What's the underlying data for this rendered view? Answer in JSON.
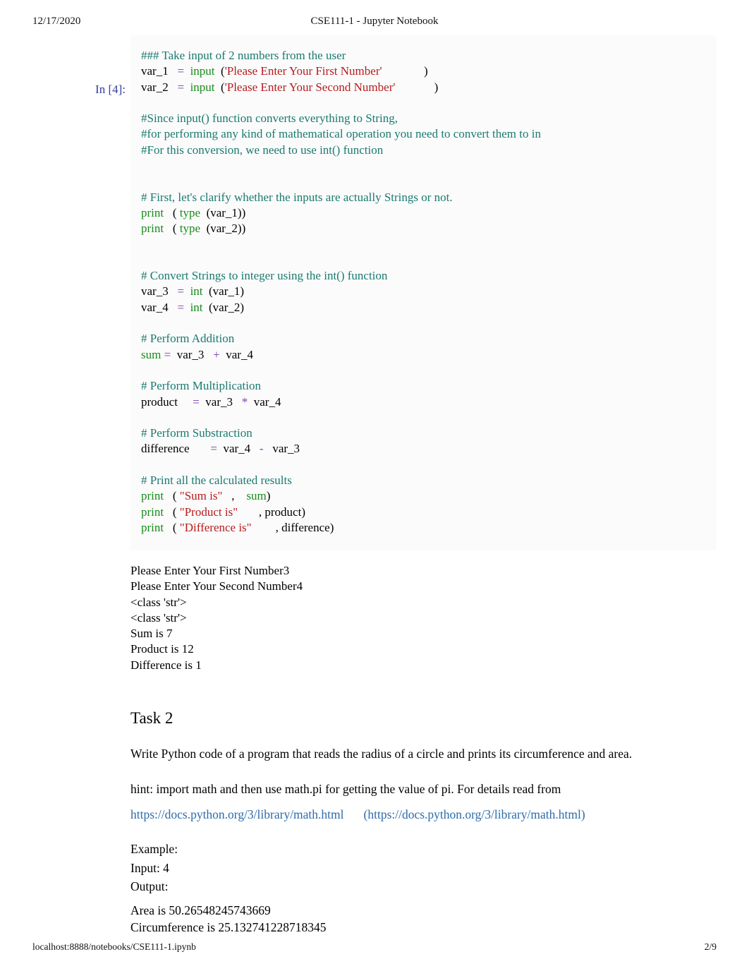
{
  "page": {
    "header": {
      "date": "12/17/2020",
      "title": "CSE111-1 - Jupyter Notebook"
    },
    "footer": {
      "url": "localhost:8888/notebooks/CSE111-1.ipynb",
      "page_number": "2/9"
    }
  },
  "colors": {
    "comment": "#1a7a6f",
    "keyword": "#198c19",
    "string": "#b71c1c",
    "operator": "#7a3ea8",
    "prompt": "#303f9f",
    "link": "#2d6ca8",
    "cell_background": "#fbfbfc",
    "page_background": "#ffffff"
  },
  "code_cell": {
    "prompt": "In [4]:",
    "lines": [
      [
        {
          "t": "### Take input of 2 numbers from the user",
          "c": "comment"
        }
      ],
      [
        {
          "t": "var_1",
          "c": "plain"
        },
        {
          "t": "   ",
          "c": "plain"
        },
        {
          "t": "=",
          "c": "operator"
        },
        {
          "t": "  ",
          "c": "plain"
        },
        {
          "t": "input",
          "c": "builtin"
        },
        {
          "t": "  (",
          "c": "plain"
        },
        {
          "t": "'Please Enter Your First Number'",
          "c": "string"
        },
        {
          "t": "              )",
          "c": "plain"
        }
      ],
      [
        {
          "t": "var_2",
          "c": "plain"
        },
        {
          "t": "   ",
          "c": "plain"
        },
        {
          "t": "=",
          "c": "operator"
        },
        {
          "t": "  ",
          "c": "plain"
        },
        {
          "t": "input",
          "c": "builtin"
        },
        {
          "t": "  (",
          "c": "plain"
        },
        {
          "t": "'Please Enter Your Second Number'",
          "c": "string"
        },
        {
          "t": "             )",
          "c": "plain"
        }
      ],
      [],
      [
        {
          "t": "#Since input() function converts everything to String,",
          "c": "comment"
        }
      ],
      [
        {
          "t": "#for performing any kind of mathematical operation you need to convert them to in",
          "c": "comment"
        }
      ],
      [
        {
          "t": "#For this conversion, we need to use int() function",
          "c": "comment"
        }
      ],
      [],
      [],
      [
        {
          "t": "# First, let's clarify whether the inputs are actually Strings or not.",
          "c": "comment"
        }
      ],
      [
        {
          "t": "print",
          "c": "builtin"
        },
        {
          "t": "   ( ",
          "c": "plain"
        },
        {
          "t": "type",
          "c": "builtin"
        },
        {
          "t": "  (var_1))",
          "c": "plain"
        }
      ],
      [
        {
          "t": "print",
          "c": "builtin"
        },
        {
          "t": "   ( ",
          "c": "plain"
        },
        {
          "t": "type",
          "c": "builtin"
        },
        {
          "t": "  (var_2))",
          "c": "plain"
        }
      ],
      [],
      [],
      [
        {
          "t": "# Convert Strings to integer using the int() function",
          "c": "comment"
        }
      ],
      [
        {
          "t": "var_3",
          "c": "plain"
        },
        {
          "t": "   ",
          "c": "plain"
        },
        {
          "t": "=",
          "c": "operator"
        },
        {
          "t": "  ",
          "c": "plain"
        },
        {
          "t": "int",
          "c": "builtin"
        },
        {
          "t": "  (var_1)",
          "c": "plain"
        }
      ],
      [
        {
          "t": "var_4",
          "c": "plain"
        },
        {
          "t": "   ",
          "c": "plain"
        },
        {
          "t": "=",
          "c": "operator"
        },
        {
          "t": "  ",
          "c": "plain"
        },
        {
          "t": "int",
          "c": "builtin"
        },
        {
          "t": "  (var_2)",
          "c": "plain"
        }
      ],
      [],
      [
        {
          "t": "# Perform Addition",
          "c": "comment"
        }
      ],
      [
        {
          "t": "sum",
          "c": "builtin"
        },
        {
          "t": " ",
          "c": "plain"
        },
        {
          "t": "=",
          "c": "operator"
        },
        {
          "t": "  var_3",
          "c": "plain"
        },
        {
          "t": "   ",
          "c": "plain"
        },
        {
          "t": "+",
          "c": "operator"
        },
        {
          "t": "  var_4",
          "c": "plain"
        }
      ],
      [],
      [
        {
          "t": "# Perform Multiplication",
          "c": "comment"
        }
      ],
      [
        {
          "t": "product",
          "c": "plain"
        },
        {
          "t": "     ",
          "c": "plain"
        },
        {
          "t": "=",
          "c": "operator"
        },
        {
          "t": "  var_3",
          "c": "plain"
        },
        {
          "t": "   ",
          "c": "plain"
        },
        {
          "t": "*",
          "c": "operator"
        },
        {
          "t": "  var_4",
          "c": "plain"
        }
      ],
      [],
      [
        {
          "t": "# Perform Substraction",
          "c": "comment"
        }
      ],
      [
        {
          "t": "difference",
          "c": "plain"
        },
        {
          "t": "       ",
          "c": "plain"
        },
        {
          "t": "=",
          "c": "operator"
        },
        {
          "t": "  var_4",
          "c": "plain"
        },
        {
          "t": "   ",
          "c": "plain"
        },
        {
          "t": "-",
          "c": "operator"
        },
        {
          "t": "   var_3",
          "c": "plain"
        }
      ],
      [],
      [
        {
          "t": "# Print all the calculated results",
          "c": "comment"
        }
      ],
      [
        {
          "t": "print",
          "c": "builtin"
        },
        {
          "t": "   ( ",
          "c": "plain"
        },
        {
          "t": "\"Sum is\"",
          "c": "string"
        },
        {
          "t": "   ,",
          "c": "plain"
        },
        {
          "t": "    ",
          "c": "plain"
        },
        {
          "t": "sum",
          "c": "builtin"
        },
        {
          "t": ")",
          "c": "plain"
        }
      ],
      [
        {
          "t": "print",
          "c": "builtin"
        },
        {
          "t": "   ( ",
          "c": "plain"
        },
        {
          "t": "\"Product is\"",
          "c": "string"
        },
        {
          "t": "       , product)",
          "c": "plain"
        }
      ],
      [
        {
          "t": "print",
          "c": "builtin"
        },
        {
          "t": "   ( ",
          "c": "plain"
        },
        {
          "t": "\"Difference is\"",
          "c": "string"
        },
        {
          "t": "        , difference)",
          "c": "plain"
        }
      ]
    ]
  },
  "output": {
    "lines": [
      "Please Enter Your First Number3",
      "Please Enter Your Second Number4",
      "<class 'str'>",
      "<class 'str'>",
      "Sum is 7",
      "Product is 12",
      "Difference is 1"
    ]
  },
  "markdown": {
    "heading": "Task 2",
    "paragraph_1": "Write Python code of a program that reads the radius of a circle and prints its circumference and area.",
    "hint_text": "hint: import math and then use math.pi for getting the value of pi. For details read from",
    "link_text": "https://docs.python.org/3/library/math.html",
    "link_paren_text": "(https://docs.python.org/3/library/math.html)",
    "example_label": "Example:",
    "input_line": "Input: 4",
    "output_label": "Output:",
    "area_line": "Area is 50.26548245743669",
    "circumference_line": "Circumference is 25.132741228718345"
  }
}
